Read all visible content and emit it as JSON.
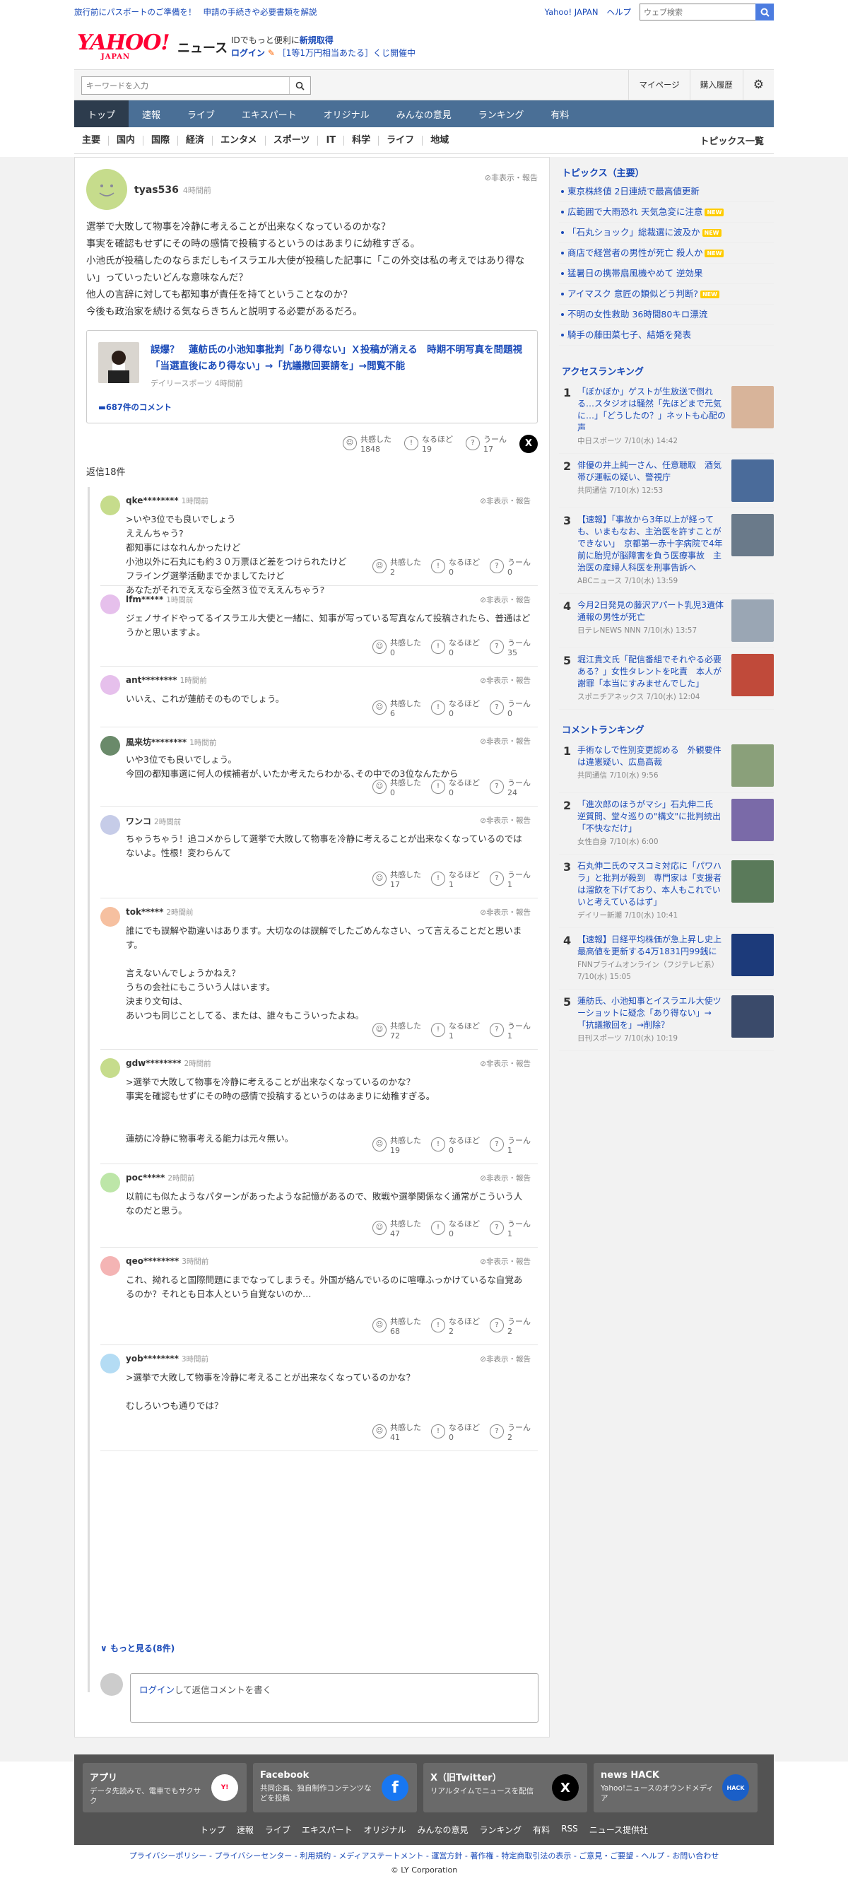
{
  "topbar": {
    "notice1": "旅行前にパスポートのご準備を！",
    "notice2": "申請の手続きや必要書類を解説",
    "yj": "Yahoo! JAPAN",
    "help": "ヘルプ",
    "web_ph": "ウェブ検索"
  },
  "header": {
    "logo": "YAHOO!",
    "logo_sub": "JAPAN",
    "news": "ニュース",
    "id_line": "IDでもっと便利に",
    "register": "新規取得",
    "login": "ログイン",
    "promo": "［1等1万円相当あたる］くじ開催中"
  },
  "search": {
    "placeholder": "キーワードを入力",
    "mypage": "マイページ",
    "history": "購入履歴"
  },
  "gnav": [
    "トップ",
    "速報",
    "ライブ",
    "エキスパート",
    "オリジナル",
    "みんなの意見",
    "ランキング",
    "有料"
  ],
  "cnav": [
    "主要",
    "国内",
    "国際",
    "経済",
    "エンタメ",
    "スポーツ",
    "IT",
    "科学",
    "ライフ",
    "地域"
  ],
  "cnav_all": "トピックス一覧",
  "post": {
    "user": "tyas536",
    "time": "4時間前",
    "hide": "非表示・報告",
    "body": [
      "選挙で大敗して物事を冷静に考えることが出来なくなっているのかな？",
      "事実を確認もせずにその時の感情で投稿するというのはあまりに幼稚すぎる。",
      "小池氏が投稿したのならまだしもイスラエル大使が投稿した記事に「この外交は私の考えではあり得ない」っていったいどんな意味なんだ？",
      "他人の言辞に対しても都知事が責任を持てということなのか？",
      "今後も政治家を続ける気ならきちんと説明する必要があるだろ。"
    ],
    "article_title": "誤爆？　蓮舫氏の小池知事批判「あり得ない」Ｘ投稿が消える　時期不明写真を問題視「当選直後にあり得ない」→「抗議撤回要請を」→閲覧不能",
    "article_src": "デイリースポーツ",
    "article_time": "4時間前",
    "comments": "687件のコメント",
    "r1": "共感した",
    "r1v": "1848",
    "r2": "なるほど",
    "r2v": "19",
    "r3": "うーん",
    "r3v": "17"
  },
  "replies_label": "返信18件",
  "replies": [
    {
      "user": "qke********",
      "time": "1時間前",
      "body": ">いや3位でも良いでしょう\nええんちゃう?\n都知事にはなれんかったけど\n小池以外に石丸にも約３０万票ほど差をつけられたけど\nフライング選挙活動までかましてたけど\nあなたがそれでええなら全然３位でええんちゃう?",
      "a": "2",
      "b": "0",
      "c": "0"
    },
    {
      "user": "lfm*****",
      "time": "1時間前",
      "body": "ジェノサイドやってるイスラエル大使と一緒に、知事が写っている写真なんて投稿されたら、普通はどうかと思いますよ。",
      "a": "0",
      "b": "0",
      "c": "35"
    },
    {
      "user": "ant********",
      "time": "1時間前",
      "body": "いいえ、これが蓮舫そのものでしょう。",
      "a": "6",
      "b": "0",
      "c": "0"
    },
    {
      "user": "風来坊********",
      "time": "1時間前",
      "body": "いや3位でも良いでしょう。\n今回の都知事選に何人の候補者が､いたか考えたらわかる､その中での3位なんたから",
      "a": "0",
      "b": "0",
      "c": "24"
    },
    {
      "user": "ワンコ",
      "time": "2時間前",
      "body": "ちゃうちゃう！追コメからして選挙で大敗して物事を冷静に考えることが出来なくなっているのではないよ。性根！変わらんて",
      "a": "17",
      "b": "1",
      "c": "1"
    },
    {
      "user": "tok*****",
      "time": "2時間前",
      "body": "誰にでも誤解や勘違いはあります。大切なのは誤解でしたごめんなさい、って言えることだと思います。\n\n言えないんでしょうかねえ？\nうちの会社にもこういう人はいます。\n決まり文句は、\nあいつも同じことしてる、または、誰々もこういったよね。",
      "a": "72",
      "b": "1",
      "c": "1"
    },
    {
      "user": "gdw********",
      "time": "2時間前",
      "body": ">選挙で大敗して物事を冷静に考えることが出来なくなっているのかな？\n事実を確認もせずにその時の感情で投稿するというのはあまりに幼稚すぎる。\n\n\n蓮舫に冷静に物事考える能力は元々無い。",
      "a": "19",
      "b": "0",
      "c": "1"
    },
    {
      "user": "poc*****",
      "time": "2時間前",
      "body": "以前にも似たようなパターンがあったような記憶があるので、敗戦や選挙関係なく通常がこういう人なのだと思う。",
      "a": "47",
      "b": "0",
      "c": "1"
    },
    {
      "user": "qeo********",
      "time": "3時間前",
      "body": "これ、拗れると国際問題にまでなってしまうそ。外国が絡んでいるのに喧嘩ふっかけているな自覚あるのか？それとも日本人という自覚ないのか…",
      "a": "68",
      "b": "2",
      "c": "2"
    },
    {
      "user": "yob********",
      "time": "3時間前",
      "body": ">選挙で大敗して物事を冷静に考えることが出来なくなっているのかな？\n\nむしろいつも通りでは？",
      "a": "41",
      "b": "0",
      "c": "2"
    }
  ],
  "more": "もっと見る",
  "more_count": "(8件)",
  "reply_login": "ログイン",
  "reply_ph": "して返信コメントを書く",
  "side": {
    "topics_title": "トピックス（主要）",
    "topics": [
      {
        "t": "東京株終値 2日連続で最高値更新",
        "new": false
      },
      {
        "t": "広範囲で大雨恐れ 天気急変に注意",
        "new": true
      },
      {
        "t": "「石丸ショック」総裁選に波及か",
        "new": true
      },
      {
        "t": "商店で経営者の男性が死亡 殺人か",
        "new": true
      },
      {
        "t": "猛暑日の携帯扇風機やめて 逆効果",
        "new": false
      },
      {
        "t": "アイマスク 意匠の類似どう判断?",
        "new": true
      },
      {
        "t": "不明の女性救助 36時間80キロ漂流",
        "new": false
      },
      {
        "t": "騎手の藤田菜七子、結婚を発表",
        "new": false
      }
    ],
    "new_label": "NEW",
    "access_title": "アクセスランキング",
    "access": [
      {
        "n": "1",
        "t": "「ぼかぼか」ゲストが生放送で倒れる…スタジオは騒然「先ほどまで元気に…」「どうしたの？」ネットも心配の声",
        "m": "中日スポーツ 7/10(水) 14:42"
      },
      {
        "n": "2",
        "t": "俳優の井上純一さん、任意聴取　酒気帯び運転の疑い、警視庁",
        "m": "共同通信 7/10(水) 12:53"
      },
      {
        "n": "3",
        "t": "【速報】「事故から3年以上が経っても、いまもなお、主治医を許すことができない」　京都第一赤十字病院で4年前に胎児が脳障害を負う医療事故　主治医の産婦人科医を刑事告訴へ",
        "m": "ABCニュース 7/10(水) 13:59"
      },
      {
        "n": "4",
        "t": "今月2日発見の藤沢アパート乳児3遺体　通報の男性が死亡",
        "m": "日テレNEWS NNN 7/10(水) 13:57"
      },
      {
        "n": "5",
        "t": "堀江貴文氏「配信番組でそれやる必要ある？」女性タレントを叱責　本人が謝罪「本当にすみませんでした」",
        "m": "スポニチアネックス 7/10(水) 12:04"
      }
    ],
    "comment_title": "コメントランキング",
    "comment": [
      {
        "n": "1",
        "t": "手術なしで性別変更認める　外観要件は違憲疑い、広島高裁",
        "m": "共同通信 7/10(水) 9:56"
      },
      {
        "n": "2",
        "t": "「進次郎のほうがマシ」石丸伸二氏　逆質問、堂々巡りの\"構文\"に批判続出「不快なだけ」",
        "m": "女性自身 7/10(水) 6:00"
      },
      {
        "n": "3",
        "t": "石丸伸二氏のマスコミ対応に「パワハラ」と批判が殺到　専門家は「支援者は溜飲を下げており、本人もこれでいいと考えているはず」",
        "m": "デイリー新潮 7/10(水) 10:41"
      },
      {
        "n": "4",
        "t": "【速報】日経平均株価が急上昇し史上最高値を更新する4万1831円99銭に",
        "m": "FNNプライムオンライン（フジテレビ系） 7/10(水) 15:05"
      },
      {
        "n": "5",
        "t": "蓮舫氏、小池知事とイスラエル大使ツーショットに疑念「あり得ない」→「抗議撤回を」→削除？",
        "m": "日刊スポーツ 7/10(水) 10:19"
      }
    ]
  },
  "footer": {
    "boxes": [
      {
        "t": "アプリ",
        "d": "データ先読みで、電車でもサクサク"
      },
      {
        "t": "Facebook",
        "d": "共同企画、独自制作コンテンツなどを投稿"
      },
      {
        "t": "X（旧Twitter）",
        "d": "リアルタイムでニュースを配信"
      },
      {
        "t": "news HACK",
        "d": "Yahoo!ニュースのオウンドメディア"
      }
    ],
    "links": [
      "トップ",
      "速報",
      "ライブ",
      "エキスパート",
      "オリジナル",
      "みんなの意見",
      "ランキング",
      "有料",
      "RSS",
      "ニュース提供社"
    ],
    "legal": "プライバシーポリシー - プライバシーセンター - 利用規約 - メディアステートメント - 運営方針 - 著作権 - 特定商取引法の表示 - ご意見・ご要望 - ヘルプ - お問い合わせ",
    "copy": "© LY Corporation"
  }
}
